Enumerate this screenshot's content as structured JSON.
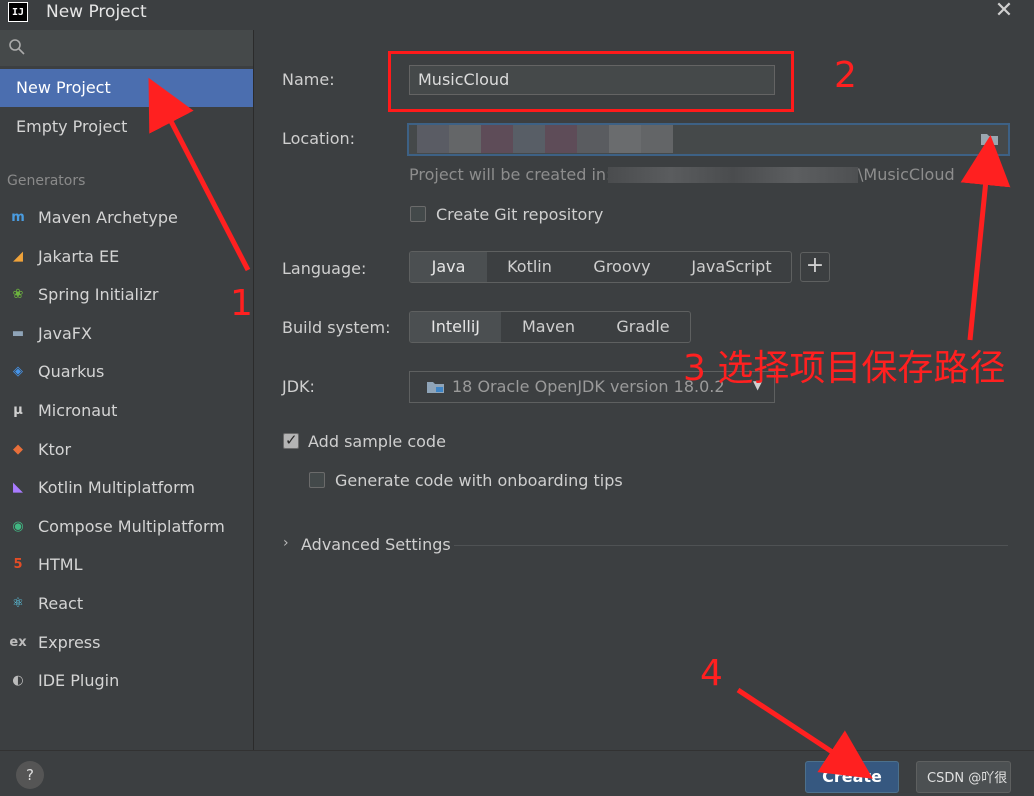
{
  "window": {
    "app_logo": "IJ",
    "title": "New Project",
    "close_icon": "close-icon"
  },
  "sidebar": {
    "search_icon": "search-icon",
    "items": [
      {
        "label": "New Project",
        "selected": true
      },
      {
        "label": "Empty Project",
        "selected": false
      }
    ],
    "generators_label": "Generators",
    "generators": [
      {
        "label": "Maven Archetype",
        "icon": "maven-icon",
        "glyph": "m",
        "color": "#4a9ce0"
      },
      {
        "label": "Jakarta EE",
        "icon": "jakarta-icon",
        "glyph": "◢",
        "color": "#f0a33a"
      },
      {
        "label": "Spring Initializr",
        "icon": "spring-icon",
        "glyph": "❀",
        "color": "#6db33f"
      },
      {
        "label": "JavaFX",
        "icon": "javafx-folder-icon",
        "glyph": "▬",
        "color": "#8fa4b8"
      },
      {
        "label": "Quarkus",
        "icon": "quarkus-icon",
        "glyph": "◈",
        "color": "#4695eb"
      },
      {
        "label": "Micronaut",
        "icon": "micronaut-icon",
        "glyph": "μ",
        "color": "#cfcfcf"
      },
      {
        "label": "Ktor",
        "icon": "ktor-icon",
        "glyph": "◆",
        "color": "#e86f3a"
      },
      {
        "label": "Kotlin Multiplatform",
        "icon": "kotlin-icon",
        "glyph": "◣",
        "color": "#a97bff"
      },
      {
        "label": "Compose Multiplatform",
        "icon": "compose-icon",
        "glyph": "◉",
        "color": "#41b883"
      },
      {
        "label": "HTML",
        "icon": "html5-icon",
        "glyph": "5",
        "color": "#e44d26"
      },
      {
        "label": "React",
        "icon": "react-icon",
        "glyph": "⚛",
        "color": "#61dafb"
      },
      {
        "label": "Express",
        "icon": "express-icon",
        "glyph": "ex",
        "color": "#bbbbbb"
      },
      {
        "label": "IDE Plugin",
        "icon": "plugin-icon",
        "glyph": "◐",
        "color": "#bbbbbb"
      }
    ]
  },
  "form": {
    "name_label": "Name:",
    "name_value": "MusicCloud",
    "location_label": "Location:",
    "location_folder_icon": "folder-icon",
    "location_hint_prefix": "Project will be created in:",
    "location_hint_suffix": "\\MusicCloud",
    "create_git_label": "Create Git repository",
    "create_git_checked": false,
    "language_label": "Language:",
    "languages": [
      "Java",
      "Kotlin",
      "Groovy",
      "JavaScript"
    ],
    "language_selected": "Java",
    "add_language": "+",
    "build_label": "Build system:",
    "build_systems": [
      "IntelliJ",
      "Maven",
      "Gradle"
    ],
    "build_selected": "IntelliJ",
    "jdk_label": "JDK:",
    "jdk_value": "18 Oracle OpenJDK version 18.0.2",
    "add_sample_label": "Add sample code",
    "add_sample_checked": true,
    "onboarding_label": "Generate code with onboarding tips",
    "onboarding_checked": false,
    "advanced_label": "Advanced Settings"
  },
  "footer": {
    "help": "?",
    "create_label": "Create",
    "watermark": "CSDN @吖很"
  },
  "annotations": {
    "step1": "1",
    "step2": "2",
    "step3": "3 选择项目保存路径",
    "step4": "4",
    "color": "#ff2020"
  }
}
